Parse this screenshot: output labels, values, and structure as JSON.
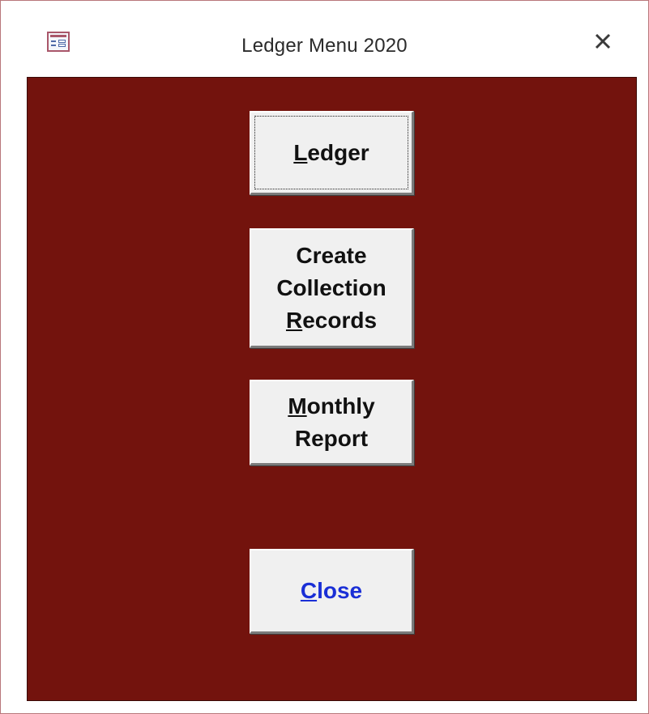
{
  "window": {
    "title": "Ledger Menu 2020",
    "app_icon": "form-icon",
    "close_icon": "close-icon",
    "client_background": "#73130d"
  },
  "buttons": {
    "ledger": {
      "prefix": "",
      "accel": "L",
      "rest": "edger"
    },
    "create_collection_records": {
      "line1": "Create",
      "line2": "Collection",
      "line3_accel": "R",
      "line3_rest": "ecords"
    },
    "monthly_report": {
      "line1_accel": "M",
      "line1_rest": "onthly",
      "line2": "Report"
    },
    "close": {
      "accel": "C",
      "rest": "lose",
      "color": "#1a2fd6"
    }
  }
}
